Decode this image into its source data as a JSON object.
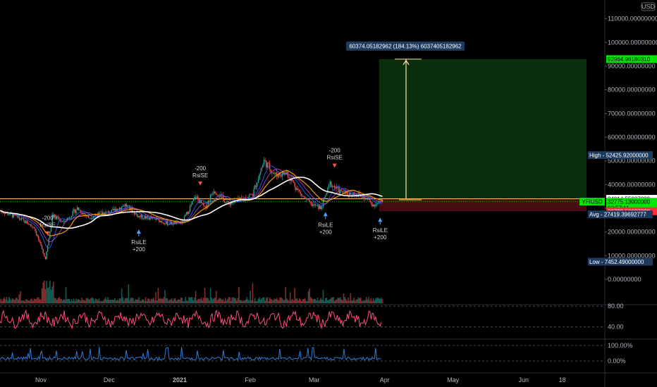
{
  "currency_button": "USD",
  "chart_data": {
    "type": "candlestick",
    "symbol": "YFIUSD",
    "price_axis": {
      "scale": "linear",
      "range": [
        -9000,
        117000
      ],
      "ticks": [
        "110000.00000000",
        "100000.00000000",
        "90000.00000000",
        "80000.00000000",
        "70000.00000000",
        "60000.00000000",
        "50000.00000000",
        "40000.00000000",
        "30000.00000000",
        "20000.00000000",
        "10000.00000000",
        "0.00000000"
      ],
      "tick_values": [
        110000,
        100000,
        90000,
        80000,
        70000,
        60000,
        50000,
        40000,
        30000,
        20000,
        10000,
        0
      ]
    },
    "time_axis": {
      "labels": [
        "Nov",
        "Dec",
        "2021",
        "Feb",
        "Mar",
        "Apr",
        "May",
        "Jun",
        "18"
      ],
      "label_days": [
        0,
        30,
        61,
        92,
        120,
        151,
        181,
        212,
        229
      ]
    },
    "price_path": [
      {
        "day": -18,
        "price": 29000
      },
      {
        "day": -10,
        "price": 26000
      },
      {
        "day": -3,
        "price": 22000
      },
      {
        "day": 2,
        "price": 8500
      },
      {
        "day": 5,
        "price": 27000
      },
      {
        "day": 10,
        "price": 24000
      },
      {
        "day": 16,
        "price": 30000
      },
      {
        "day": 21,
        "price": 26000
      },
      {
        "day": 25,
        "price": 27500
      },
      {
        "day": 31,
        "price": 28500
      },
      {
        "day": 37,
        "price": 31500
      },
      {
        "day": 43,
        "price": 26500
      },
      {
        "day": 50,
        "price": 25500
      },
      {
        "day": 56,
        "price": 23500
      },
      {
        "day": 62,
        "price": 24000
      },
      {
        "day": 68,
        "price": 35000
      },
      {
        "day": 72,
        "price": 30000
      },
      {
        "day": 76,
        "price": 38000
      },
      {
        "day": 82,
        "price": 32000
      },
      {
        "day": 88,
        "price": 33500
      },
      {
        "day": 93,
        "price": 36000
      },
      {
        "day": 98,
        "price": 50000
      },
      {
        "day": 103,
        "price": 44000
      },
      {
        "day": 108,
        "price": 45000
      },
      {
        "day": 114,
        "price": 36000
      },
      {
        "day": 118,
        "price": 32000
      },
      {
        "day": 123,
        "price": 30000
      },
      {
        "day": 127,
        "price": 40500
      },
      {
        "day": 132,
        "price": 36500
      },
      {
        "day": 138,
        "price": 36000
      },
      {
        "day": 143,
        "price": 34000
      },
      {
        "day": 146,
        "price": 31500
      },
      {
        "day": 150,
        "price": 32775
      }
    ],
    "high": {
      "label": "High",
      "value": "52425.92000000"
    },
    "low": {
      "label": "Low",
      "value": "7452.49000000"
    },
    "avg": {
      "label": "Avg",
      "value": "27419.39692777"
    },
    "last_price": "32775.13000000",
    "countdown": "03:57:11",
    "entry_price": "34014.55037289",
    "stop_price": "28729.56637289",
    "target_price": "92964.96180310",
    "measure_label": "60374.05182962 (184.13%) 6037405182962",
    "signals": [
      {
        "day": 3,
        "type": "short",
        "line1": "-200",
        "line2": "RsiSE"
      },
      {
        "day": 43,
        "type": "long",
        "line1": "RsiLE",
        "line2": "+200"
      },
      {
        "day": 70,
        "type": "short",
        "line1": "-200",
        "line2": "RsiSE"
      },
      {
        "day": 125,
        "type": "long",
        "line1": "RsiLE",
        "line2": "+200"
      },
      {
        "day": 129,
        "type": "short",
        "line1": "-200",
        "line2": "RsiSE"
      },
      {
        "day": 149,
        "type": "long",
        "line1": "RsiLE",
        "line2": "+200"
      }
    ],
    "rsi_pane": {
      "ticks": [
        "80.00",
        "40.00"
      ],
      "tick_values": [
        80,
        40
      ]
    },
    "pct_pane": {
      "ticks": [
        "100.00%",
        "0.00%"
      ],
      "tick_values": [
        100,
        0
      ]
    },
    "colors": {
      "up": "#26a69a",
      "down": "#ef5350",
      "rsi": "#ff4d78",
      "pct": "#2e7bd6",
      "profit_zone": "#0f3d12",
      "loss_zone": "#5a1018",
      "target_badge": "#00e600",
      "last_badge": "#00e600",
      "stop_badge": "#ff2a3a",
      "entry_badge": "#ffffff",
      "stat_badge": "#1e3a5f"
    }
  }
}
